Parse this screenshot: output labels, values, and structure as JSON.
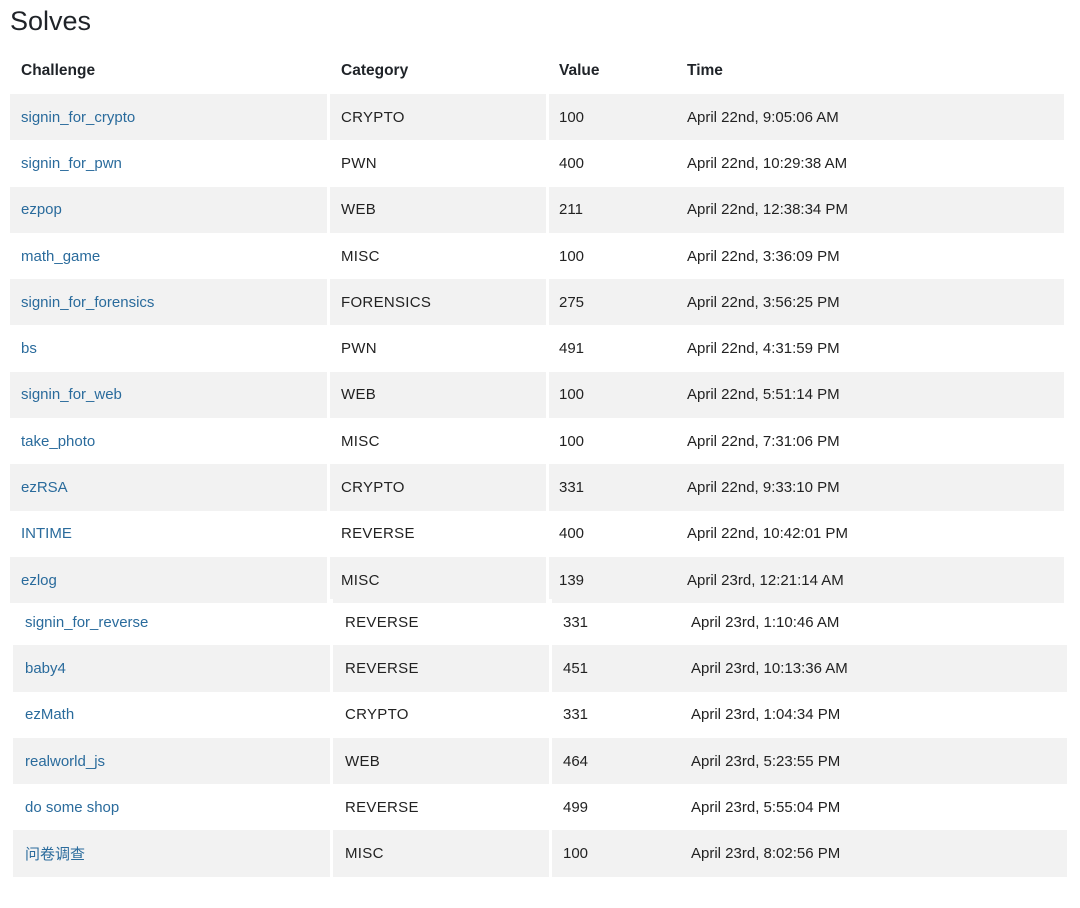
{
  "page": {
    "title": "Solves"
  },
  "table": {
    "headers": {
      "challenge": "Challenge",
      "category": "Category",
      "value": "Value",
      "time": "Time"
    },
    "rows": [
      {
        "challenge": "signin_for_crypto",
        "category": "CRYPTO",
        "value": "100",
        "time": "April 22nd, 9:05:06 AM"
      },
      {
        "challenge": "signin_for_pwn",
        "category": "PWN",
        "value": "400",
        "time": "April 22nd, 10:29:38 AM"
      },
      {
        "challenge": "ezpop",
        "category": "WEB",
        "value": "211",
        "time": "April 22nd, 12:38:34 PM"
      },
      {
        "challenge": "math_game",
        "category": "MISC",
        "value": "100",
        "time": "April 22nd, 3:36:09 PM"
      },
      {
        "challenge": "signin_for_forensics",
        "category": "FORENSICS",
        "value": "275",
        "time": "April 22nd, 3:56:25 PM"
      },
      {
        "challenge": "bs",
        "category": "PWN",
        "value": "491",
        "time": "April 22nd, 4:31:59 PM"
      },
      {
        "challenge": "signin_for_web",
        "category": "WEB",
        "value": "100",
        "time": "April 22nd, 5:51:14 PM"
      },
      {
        "challenge": "take_photo",
        "category": "MISC",
        "value": "100",
        "time": "April 22nd, 7:31:06 PM"
      },
      {
        "challenge": "ezRSA",
        "category": "CRYPTO",
        "value": "331",
        "time": "April 22nd, 9:33:10 PM"
      },
      {
        "challenge": "INTIME",
        "category": "REVERSE",
        "value": "400",
        "time": "April 22nd, 10:42:01 PM"
      },
      {
        "challenge": "ezlog",
        "category": "MISC",
        "value": "139",
        "time": "April 23rd, 12:21:14 AM"
      },
      {
        "challenge": "signin_for_reverse",
        "category": "REVERSE",
        "value": "331",
        "time": "April 23rd, 1:10:46 AM"
      },
      {
        "challenge": "baby4",
        "category": "REVERSE",
        "value": "451",
        "time": "April 23rd, 10:13:36 AM"
      },
      {
        "challenge": "ezMath",
        "category": "CRYPTO",
        "value": "331",
        "time": "April 23rd, 1:04:34 PM"
      },
      {
        "challenge": "realworld_js",
        "category": "WEB",
        "value": "464",
        "time": "April 23rd, 5:23:55 PM"
      },
      {
        "challenge": "do some shop",
        "category": "REVERSE",
        "value": "499",
        "time": "April 23rd, 5:55:04 PM"
      },
      {
        "challenge": "问卷调查",
        "category": "MISC",
        "value": "100",
        "time": "April 23rd, 8:02:56 PM"
      }
    ]
  },
  "colors": {
    "link": "#2a6b9c",
    "stripe": "#f2f2f2"
  }
}
